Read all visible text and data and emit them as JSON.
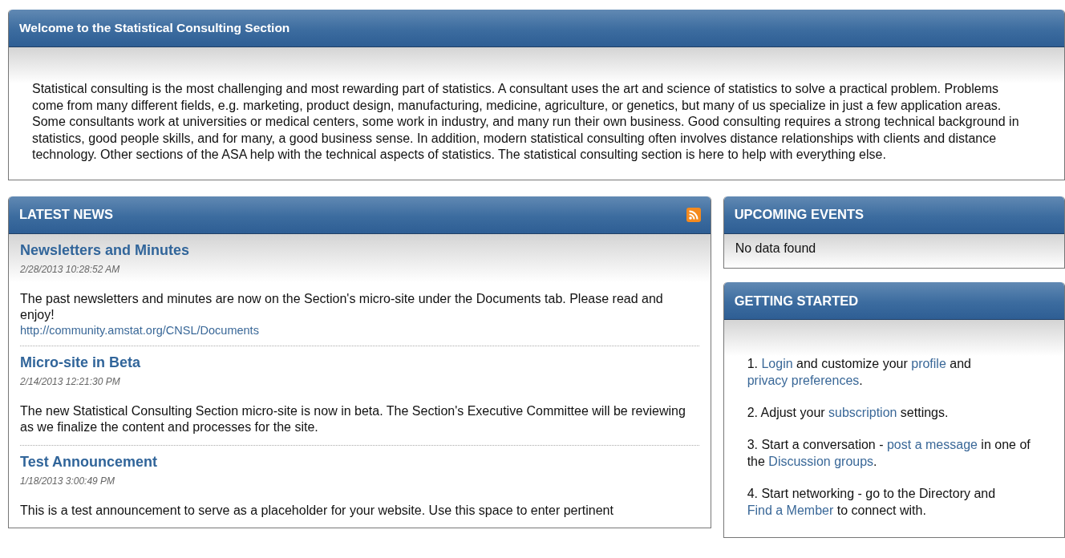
{
  "welcome": {
    "title": "Welcome to the Statistical Consulting Section",
    "text": "Statistical consulting is the most challenging and most rewarding part of statistics. A consultant uses the art and science of statistics to solve a practical problem. Problems come from many different fields, e.g. marketing, product design, manufacturing, medicine, agriculture, or genetics, but many of us specialize in just a few application areas. Some consultants work at universities or medical centers, some work in industry, and many run their own business. Good consulting requires a strong technical background in statistics, good people skills, and for many, a good business sense. In addition, modern statistical consulting often involves distance relationships with clients and distance technology. Other sections of the ASA help with the technical aspects of statistics. The statistical consulting section is here to help with everything else."
  },
  "latest_news": {
    "title": "LATEST NEWS",
    "items": [
      {
        "title": "Newsletters and Minutes",
        "date": "2/28/2013 10:28:52 AM",
        "body": "The past newsletters and minutes are now on the Section's micro-site under the Documents tab. Please read and enjoy!",
        "link": "http://community.amstat.org/CNSL/Documents"
      },
      {
        "title": "Micro-site in Beta",
        "date": "2/14/2013 12:21:30 PM",
        "body": "The new Statistical Consulting Section micro-site is now in beta. The Section's Executive Committee will be reviewing as we finalize the content and processes for the site."
      },
      {
        "title": "Test Announcement",
        "date": "1/18/2013 3:00:49 PM",
        "body": "This is a test announcement to serve as a placeholder for your website. Use this space to enter pertinent"
      }
    ]
  },
  "upcoming_events": {
    "title": "UPCOMING EVENTS",
    "empty_text": "No data found"
  },
  "getting_started": {
    "title": "GETTING STARTED",
    "steps": [
      [
        {
          "text": "1. "
        },
        {
          "text": "Login",
          "link": true
        },
        {
          "text": " and customize your "
        },
        {
          "text": "profile",
          "link": true
        },
        {
          "text": " and "
        },
        {
          "text": "privacy preferences",
          "link": true
        },
        {
          "text": "."
        }
      ],
      [
        {
          "text": "2. Adjust your "
        },
        {
          "text": "subscription",
          "link": true
        },
        {
          "text": " settings."
        }
      ],
      [
        {
          "text": "3. Start a conversation - "
        },
        {
          "text": "post a message",
          "link": true
        },
        {
          "text": " in one of the "
        },
        {
          "text": "Discussion groups",
          "link": true
        },
        {
          "text": "."
        }
      ],
      [
        {
          "text": "4. Start networking - go to the Directory and "
        },
        {
          "text": "Find a Member",
          "link": true
        },
        {
          "text": " to connect with."
        }
      ]
    ]
  }
}
